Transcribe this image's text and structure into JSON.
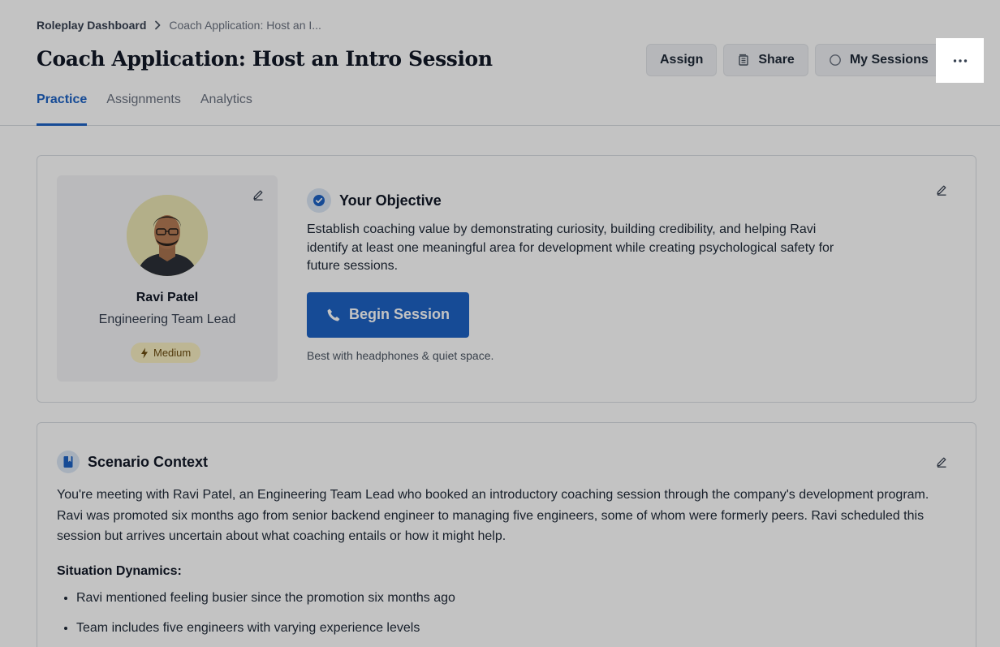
{
  "breadcrumb": {
    "parent": "Roleplay Dashboard",
    "current": "Coach Application: Host an I..."
  },
  "header": {
    "title": "Coach Application: Host an Intro Session",
    "actions": {
      "assign": "Assign",
      "share": "Share",
      "sessions": "My Sessions"
    }
  },
  "tabs": [
    {
      "label": "Practice",
      "active": true
    },
    {
      "label": "Assignments",
      "active": false
    },
    {
      "label": "Analytics",
      "active": false
    }
  ],
  "persona": {
    "name": "Ravi Patel",
    "role": "Engineering Team Lead",
    "difficulty": "Medium"
  },
  "objective": {
    "title": "Your Objective",
    "text": "Establish coaching value by demonstrating curiosity, building credibility, and helping Ravi identify at least one meaningful area for development while creating psychological safety for future sessions.",
    "begin_label": "Begin Session",
    "hint": "Best with headphones & quiet space."
  },
  "context": {
    "title": "Scenario Context",
    "body": "You're meeting with Ravi Patel, an Engineering Team Lead who booked an introductory coaching session through the company's development program. Ravi was promoted six months ago from senior backend engineer to managing five engineers, some of whom were formerly peers. Ravi scheduled this session but arrives uncertain about what coaching entails or how it might help.",
    "dynamics_title": "Situation Dynamics:",
    "dynamics": [
      "Ravi mentioned feeling busier since the promotion six months ago",
      "Team includes five engineers with varying experience levels"
    ]
  },
  "colors": {
    "accent": "#1e63c4",
    "badge_bg": "#f7efc2",
    "overlay": "rgba(0,0,0,0.235)"
  },
  "icons": [
    "chevron-right-icon",
    "share-icon",
    "circle-icon",
    "more-icon",
    "edit-icon",
    "check-badge-icon",
    "phone-icon",
    "bolt-icon",
    "book-icon"
  ]
}
